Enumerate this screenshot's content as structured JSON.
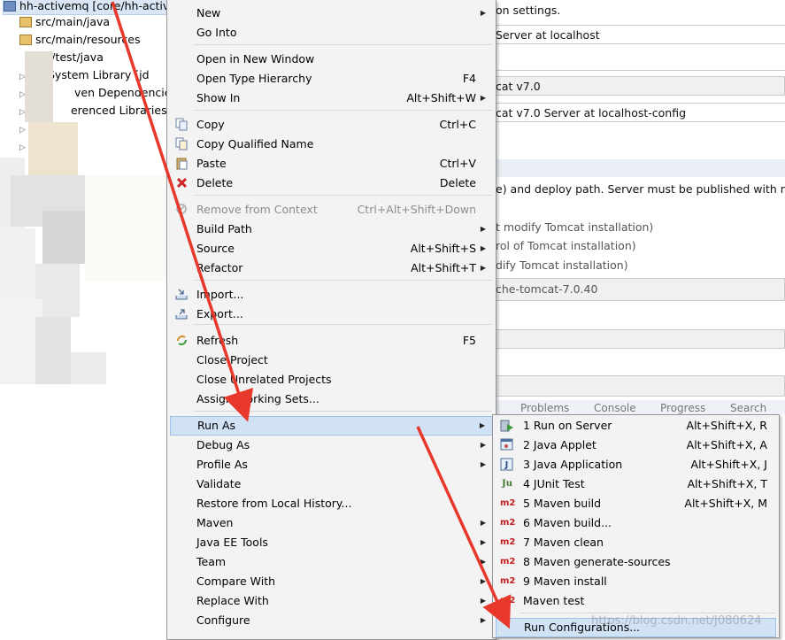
{
  "tree": {
    "project": "hh-activemq [core/hh-activemq]",
    "items": [
      "src/main/java",
      "src/main/resources",
      "src/test/java",
      "System Library [jd",
      "ven Dependencies",
      "erenced Libraries"
    ]
  },
  "editor": {
    "lines": [
      "on settings.",
      "Server at localhost",
      "cat v7.0",
      "cat v7.0 Server at localhost-config",
      "e) and deploy path. Server must be published with no m",
      "t modify Tomcat installation)",
      "rol of Tomcat installation)",
      "dify Tomcat installation)",
      "che-tomcat-7.0.40"
    ],
    "tabs": [
      "Problems",
      "Console",
      "Progress",
      "Search"
    ]
  },
  "menu": {
    "items": [
      {
        "label": "New",
        "arrow": true
      },
      {
        "label": "Go Into"
      },
      {
        "label": "Open in New Window"
      },
      {
        "label": "Open Type Hierarchy",
        "shortcut": "F4"
      },
      {
        "label": "Show In",
        "shortcut": "Alt+Shift+W",
        "arrow": true
      },
      {
        "label": "Copy",
        "shortcut": "Ctrl+C",
        "icon": "copy-icon"
      },
      {
        "label": "Copy Qualified Name",
        "icon": "copy-qualified-name-icon"
      },
      {
        "label": "Paste",
        "shortcut": "Ctrl+V",
        "icon": "paste-icon"
      },
      {
        "label": "Delete",
        "shortcut": "Delete",
        "icon": "delete-icon"
      },
      {
        "label": "Remove from Context",
        "shortcut": "Ctrl+Alt+Shift+Down",
        "disabled": true,
        "icon": "remove-context-icon"
      },
      {
        "label": "Build Path",
        "arrow": true
      },
      {
        "label": "Source",
        "shortcut": "Alt+Shift+S",
        "arrow": true
      },
      {
        "label": "Refactor",
        "shortcut": "Alt+Shift+T",
        "arrow": true
      },
      {
        "label": "Import...",
        "icon": "import-icon"
      },
      {
        "label": "Export...",
        "icon": "export-icon"
      },
      {
        "label": "Refresh",
        "shortcut": "F5",
        "icon": "refresh-icon"
      },
      {
        "label": "Close Project"
      },
      {
        "label": "Close Unrelated Projects"
      },
      {
        "label": "Assign Working Sets..."
      },
      {
        "label": "Run As",
        "arrow": true,
        "highlighted": true
      },
      {
        "label": "Debug As",
        "arrow": true
      },
      {
        "label": "Profile As",
        "arrow": true
      },
      {
        "label": "Validate"
      },
      {
        "label": "Restore from Local History..."
      },
      {
        "label": "Maven",
        "arrow": true
      },
      {
        "label": "Java EE Tools",
        "arrow": true
      },
      {
        "label": "Team",
        "arrow": true
      },
      {
        "label": "Compare With",
        "arrow": true
      },
      {
        "label": "Replace With",
        "arrow": true
      },
      {
        "label": "Configure",
        "arrow": true
      }
    ]
  },
  "submenu": {
    "items": [
      {
        "label": "1 Run on Server",
        "shortcut": "Alt+Shift+X, R",
        "icon": "run-on-server-icon",
        "glyph": ""
      },
      {
        "label": "2 Java Applet",
        "shortcut": "Alt+Shift+X, A",
        "icon": "java-applet-icon",
        "glyph": ""
      },
      {
        "label": "3 Java Application",
        "shortcut": "Alt+Shift+X, J",
        "icon": "java-application-icon",
        "glyph": "J"
      },
      {
        "label": "4 JUnit Test",
        "shortcut": "Alt+Shift+X, T",
        "icon": "junit-icon",
        "glyph": "Ju"
      },
      {
        "label": "5 Maven build",
        "shortcut": "Alt+Shift+X, M",
        "icon": "maven-icon",
        "glyph": "m2"
      },
      {
        "label": "6 Maven build...",
        "icon": "maven-icon",
        "glyph": "m2"
      },
      {
        "label": "7 Maven clean",
        "icon": "maven-icon",
        "glyph": "m2"
      },
      {
        "label": "8 Maven generate-sources",
        "icon": "maven-icon",
        "glyph": "m2"
      },
      {
        "label": "9 Maven install",
        "icon": "maven-icon",
        "glyph": "m2"
      },
      {
        "label": "Maven test",
        "icon": "maven-icon",
        "glyph": "m2"
      },
      {
        "label": "Run Configurations...",
        "highlighted": true
      }
    ]
  },
  "watermark": "https://blog.csdn.net/J080624",
  "colors": {
    "arrow": "#e8382b",
    "highlight": "#d1e2f5",
    "menu_bg": "#f3f3f3"
  }
}
